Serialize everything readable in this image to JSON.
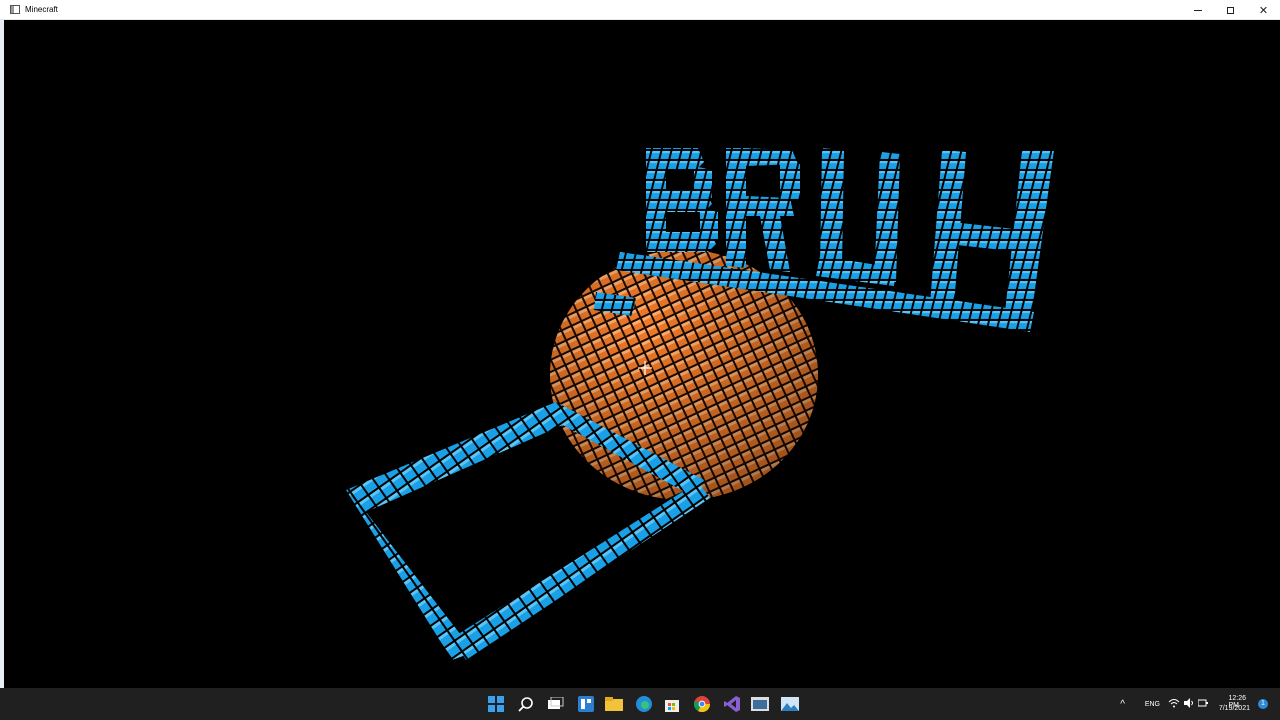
{
  "window": {
    "title": "Minecraft",
    "controls": {
      "minimize": "—",
      "maximize": "☐",
      "close": "✕"
    }
  },
  "scene": {
    "background": "#000000",
    "sign_color": "#1aa0e6",
    "sphere_color": "#f07a28",
    "block_outline": "#000000",
    "crosshair_icon": "crosshair-icon"
  },
  "taskbar": {
    "icons": [
      "windows-start-icon",
      "search-icon",
      "task-view-icon",
      "widgets-icon",
      "file-explorer-icon",
      "edge-icon",
      "store-icon",
      "chrome-icon",
      "visual-studio-icon",
      "minecraft-app-icon",
      "photos-icon"
    ],
    "tray": {
      "chevron": "^",
      "language": "ENG",
      "time": "12:26 PM",
      "date": "7/19/2021",
      "notification_count": "1"
    }
  }
}
